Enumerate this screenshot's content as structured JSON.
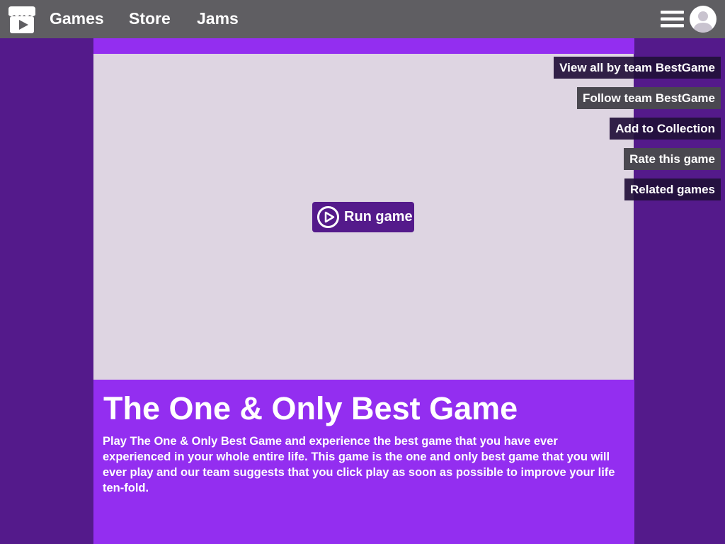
{
  "nav": {
    "logo_icon": "itch-logo-icon",
    "links": [
      "Games",
      "Store",
      "Jams"
    ],
    "menu_icon": "hamburger-menu-icon",
    "avatar_icon": "user-avatar-icon"
  },
  "game": {
    "run_label": "Run game",
    "run_icon": "play-circle-icon",
    "title": "The One & Only Best Game",
    "description": "Play The One & Only Best Game and experience the best game that you have ever experienced in your whole entire life. This game is the one and only best game that you will ever play and our team suggests that you click play as soon as possible to improve your life ten-fold."
  },
  "actions": {
    "view_all": "View all by team BestGame",
    "follow": "Follow team BestGame",
    "add_collection": "Add to Collection",
    "rate": "Rate this game",
    "related": "Related games"
  },
  "colors": {
    "topbar": "#5f5e62",
    "page_bg": "#541a8b",
    "accent": "#932ef0",
    "game_frame": "#ded5e2"
  }
}
